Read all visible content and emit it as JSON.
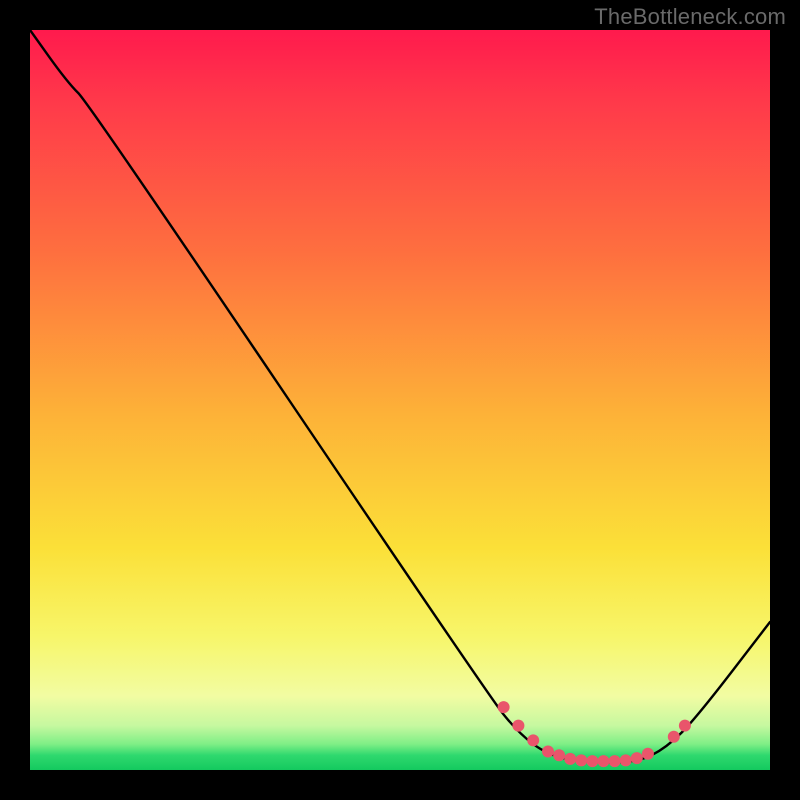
{
  "watermark": "TheBottleneck.com",
  "colors": {
    "background": "#000000",
    "curve_stroke": "#000000",
    "marker_fill": "#e9556b",
    "marker_stroke": "#e9556b"
  },
  "chart_data": {
    "type": "line",
    "title": "",
    "xlabel": "",
    "ylabel": "",
    "xlim": [
      0,
      100
    ],
    "ylim": [
      0,
      100
    ],
    "grid": false,
    "legend": false,
    "curve": [
      {
        "x": 0,
        "y": 100
      },
      {
        "x": 5,
        "y": 93
      },
      {
        "x": 8,
        "y": 90
      },
      {
        "x": 62,
        "y": 10
      },
      {
        "x": 66,
        "y": 5
      },
      {
        "x": 70,
        "y": 2
      },
      {
        "x": 75,
        "y": 1
      },
      {
        "x": 82,
        "y": 1
      },
      {
        "x": 86,
        "y": 3
      },
      {
        "x": 90,
        "y": 7
      },
      {
        "x": 100,
        "y": 20
      }
    ],
    "markers": [
      {
        "x": 64,
        "y": 8.5
      },
      {
        "x": 66,
        "y": 6.0
      },
      {
        "x": 68,
        "y": 4.0
      },
      {
        "x": 70,
        "y": 2.5
      },
      {
        "x": 71.5,
        "y": 2.0
      },
      {
        "x": 73,
        "y": 1.5
      },
      {
        "x": 74.5,
        "y": 1.3
      },
      {
        "x": 76,
        "y": 1.2
      },
      {
        "x": 77.5,
        "y": 1.2
      },
      {
        "x": 79,
        "y": 1.2
      },
      {
        "x": 80.5,
        "y": 1.3
      },
      {
        "x": 82,
        "y": 1.6
      },
      {
        "x": 83.5,
        "y": 2.2
      },
      {
        "x": 87,
        "y": 4.5
      },
      {
        "x": 88.5,
        "y": 6.0
      }
    ]
  }
}
